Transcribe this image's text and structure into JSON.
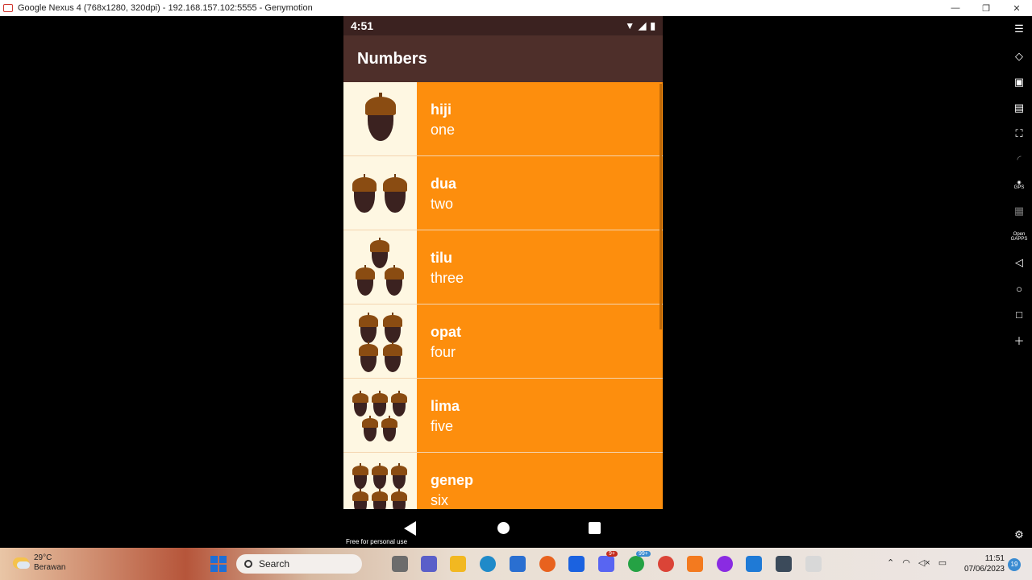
{
  "window": {
    "title": "Google Nexus 4 (768x1280, 320dpi) - 192.168.157.102:5555 - Genymotion",
    "minimize": "—",
    "maximize": "❐",
    "close": "✕"
  },
  "device": {
    "status_time": "4:51",
    "app_title": "Numbers",
    "watermark": "Free for personal use"
  },
  "numbers": [
    {
      "miwok": "hiji",
      "english": "one",
      "count": 1
    },
    {
      "miwok": "dua",
      "english": "two",
      "count": 2
    },
    {
      "miwok": "tilu",
      "english": "three",
      "count": 3
    },
    {
      "miwok": "opat",
      "english": "four",
      "count": 4
    },
    {
      "miwok": "lima",
      "english": "five",
      "count": 5
    },
    {
      "miwok": "genep",
      "english": "six",
      "count": 6
    }
  ],
  "colors": {
    "text_container": "#fd8e0d",
    "image_bg": "#fef7e2",
    "app_bar": "#4e2f2a",
    "status_bar": "#3b2220"
  },
  "taskbar": {
    "temperature": "29°C",
    "weather": "Berawan",
    "search_label": "Search",
    "discord_badge": "9+",
    "whatsapp_badge": "99+",
    "time": "11:51",
    "date": "07/06/2023",
    "notification_count": "19"
  }
}
